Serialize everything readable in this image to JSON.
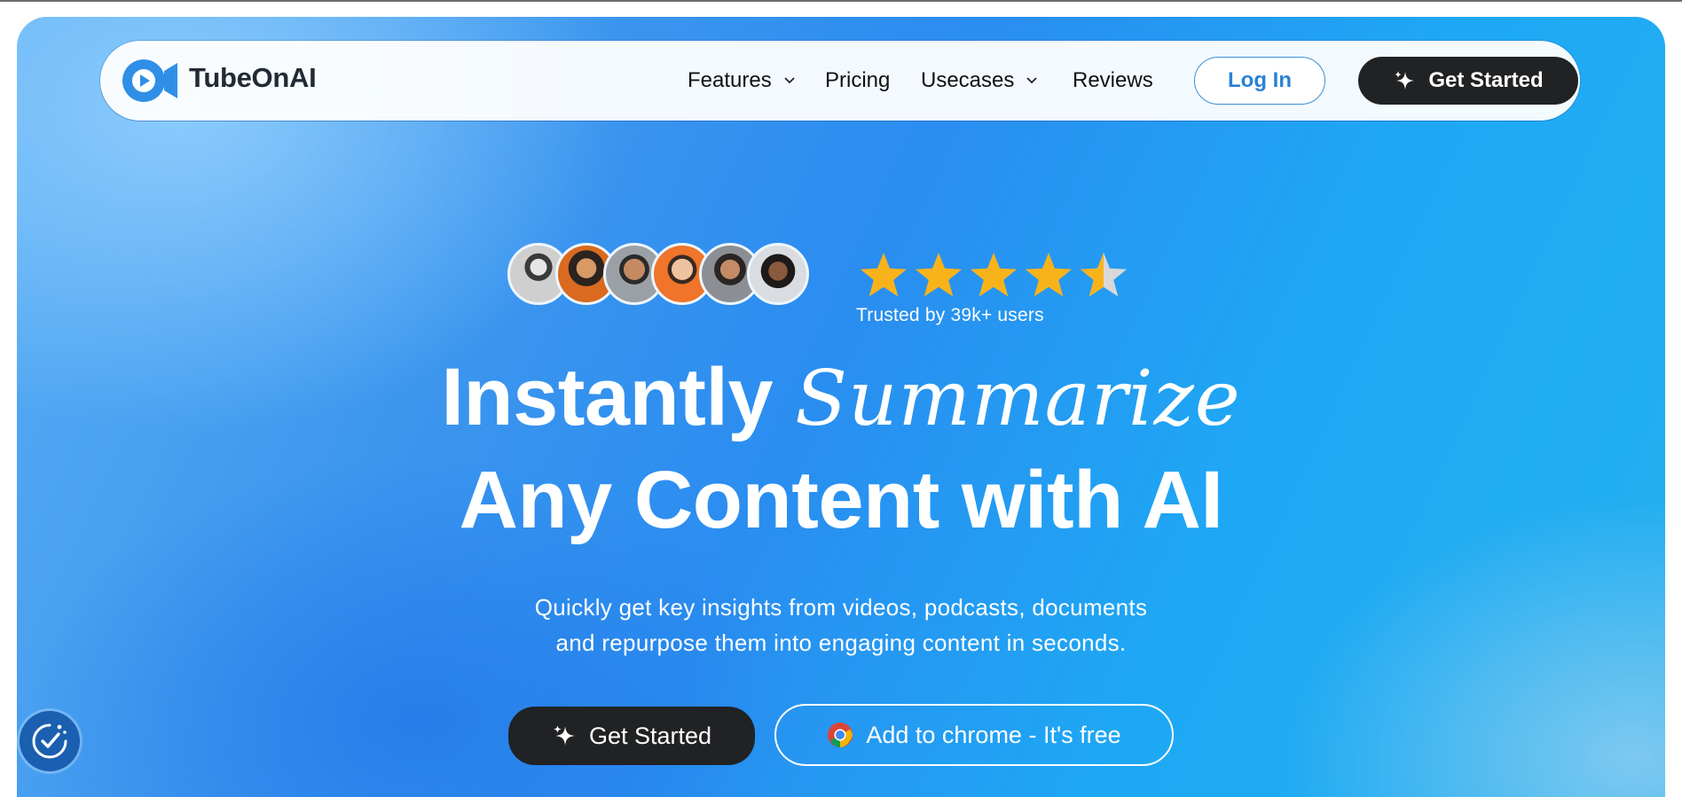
{
  "brand": {
    "name": "TubeOnAI",
    "logo_icon": "play-camera-logo-icon",
    "accent": "#2f8fe6"
  },
  "nav": {
    "links": [
      {
        "label": "Features",
        "has_dropdown": true
      },
      {
        "label": "Pricing",
        "has_dropdown": false
      },
      {
        "label": "Usecases",
        "has_dropdown": true
      },
      {
        "label": "Reviews",
        "has_dropdown": false
      }
    ],
    "login_label": "Log In",
    "get_started_label": "Get Started"
  },
  "hero": {
    "rating": {
      "stars": 4.5,
      "max": 5,
      "trusted_text": "Trusted by 39k+ users",
      "star_color": "#f9b31a"
    },
    "avatars": [
      "user-avatar-1",
      "user-avatar-2",
      "user-avatar-3",
      "user-avatar-4",
      "user-avatar-5",
      "user-avatar-6"
    ],
    "headline_prefix": "Instantly",
    "headline_emphasis": "Summarize",
    "headline_line2": "Any Content with AI",
    "subtitle_line1": "Quickly get key insights from videos, podcasts, documents",
    "subtitle_line2": "and repurpose them into engaging content in seconds.",
    "cta_primary": "Get Started",
    "cta_secondary": "Add to chrome - It's free"
  },
  "widgets": {
    "accessibility_icon": "accessibility-check-icon"
  }
}
